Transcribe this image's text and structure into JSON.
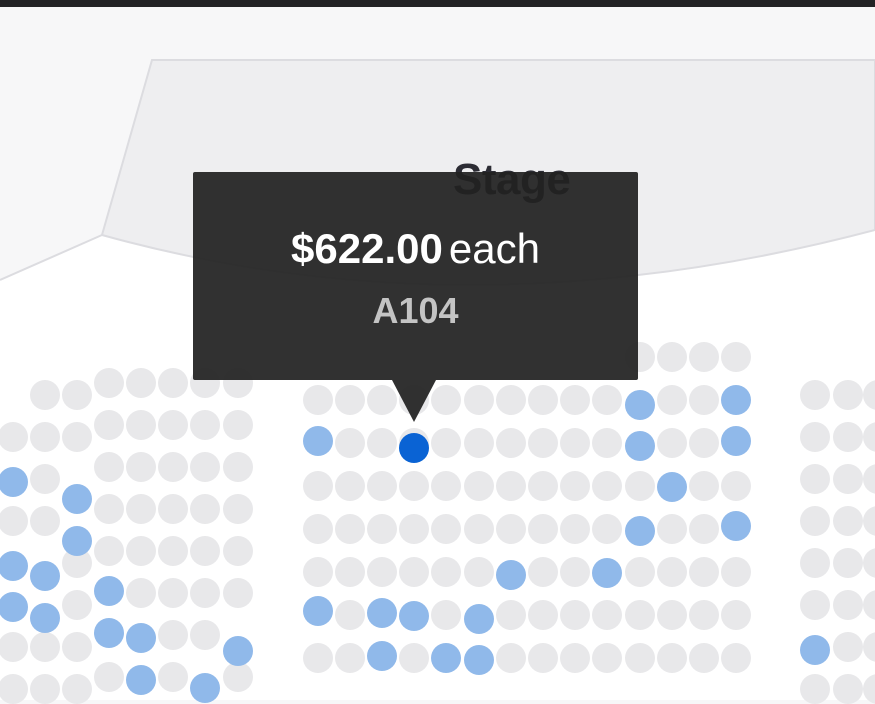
{
  "stage": {
    "label": "Stage"
  },
  "tooltip": {
    "price": "$622.00",
    "unit": "each",
    "seat": "A104"
  },
  "colors": {
    "seat_unavailable": "#e8e8ea",
    "seat_available": "#90b9ea",
    "seat_selected": "#0a63d4",
    "tooltip_bg": "#212121"
  },
  "seats": {
    "selected": "A104"
  }
}
